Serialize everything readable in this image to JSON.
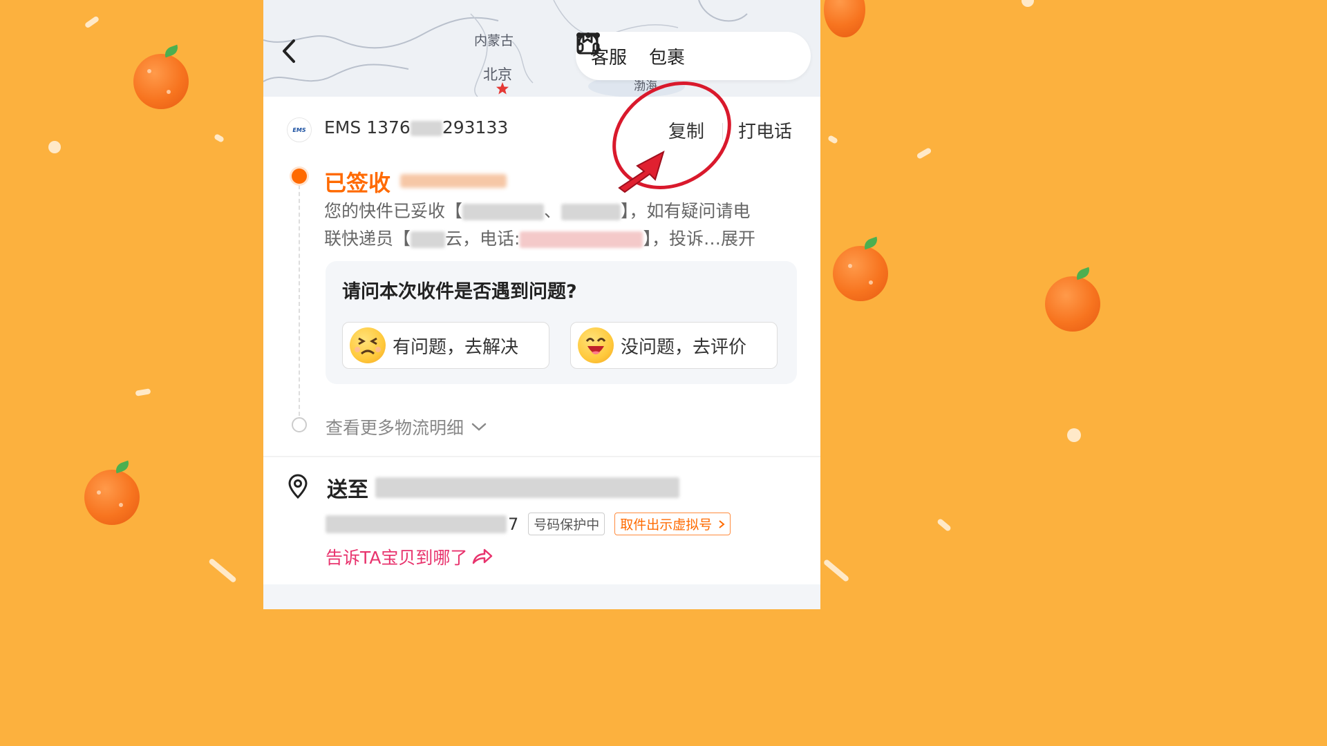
{
  "map": {
    "labels": [
      "内蒙古",
      "北京",
      "渤海"
    ]
  },
  "header": {
    "back_icon": "chevron-left-icon",
    "customer_service_label": "客服",
    "package_label": "包裹",
    "more_icon": "ellipsis-icon"
  },
  "shipment": {
    "carrier_logo": "EMS",
    "carrier": "EMS",
    "tracking_prefix": "1376",
    "tracking_suffix": "293133",
    "copy_label": "复制",
    "call_label": "打电话",
    "status": "已签收",
    "detail_line1_a": "您的快件已妥收【",
    "detail_line1_b": "】，如有疑问请电",
    "detail_line2_a": "联快递员【",
    "detail_line2_b": "云，电话:",
    "detail_line2_c": "】，投诉…展开"
  },
  "survey": {
    "question": "请问本次收件是否遇到问题?",
    "has_problem_label": "有问题，去解决",
    "no_problem_label": "没问题，去评价"
  },
  "more_details_label": "查看更多物流明细",
  "address": {
    "deliver_to_label": "送至",
    "phone_tail": "7",
    "privacy_tag": "号码保护中",
    "virtual_number_tag": "取件出示虚拟号",
    "tell_link": "告诉TA宝贝到哪了"
  },
  "colors": {
    "accent_orange": "#ff6a00",
    "link_pink": "#e8336d",
    "annotation_red": "#d9192c",
    "background": "#fcb13e"
  }
}
